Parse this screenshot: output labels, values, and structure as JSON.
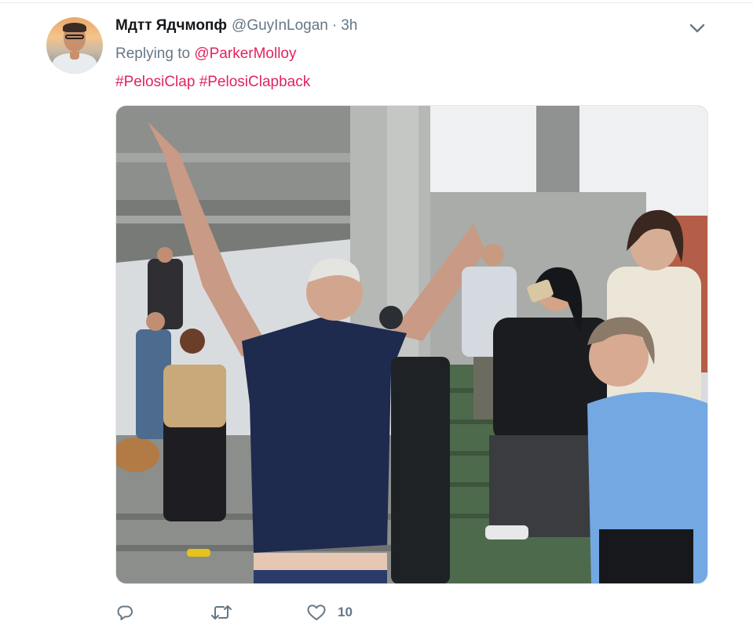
{
  "tweet": {
    "author": {
      "name": "Мдтт Ядчмопф",
      "handle": "@GuyInLogan",
      "separator": "·",
      "time": "3h"
    },
    "replying_prefix": "Replying to",
    "replying_to": "@ParkerMolloy",
    "hashtags": [
      "#PelosiClap",
      "#PelosiClapback"
    ],
    "media_alt": "Photo: man in navy polo raising both arms making peace signs outdoors beside concrete building, photographers behind, woman in white jacket clapping at right, woman in blue shirt in foreground",
    "actions": {
      "reply_icon": "reply-icon",
      "retweet_icon": "retweet-icon",
      "like_icon": "heart-icon",
      "like_count": "10"
    }
  },
  "colors": {
    "link": "#e0245e",
    "muted": "#657786",
    "text": "#14171a",
    "border": "#e1e8ed"
  }
}
